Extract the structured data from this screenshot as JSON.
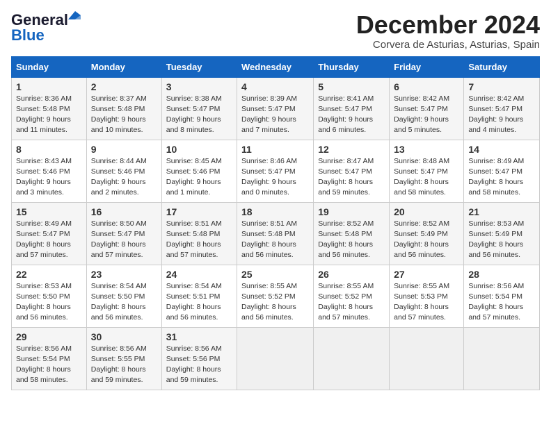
{
  "header": {
    "logo_line1": "General",
    "logo_line2": "Blue",
    "month_title": "December 2024",
    "location": "Corvera de Asturias, Asturias, Spain"
  },
  "weekdays": [
    "Sunday",
    "Monday",
    "Tuesday",
    "Wednesday",
    "Thursday",
    "Friday",
    "Saturday"
  ],
  "weeks": [
    [
      {
        "day": "1",
        "sunrise": "8:36 AM",
        "sunset": "5:48 PM",
        "daylight": "9 hours and 11 minutes."
      },
      {
        "day": "2",
        "sunrise": "8:37 AM",
        "sunset": "5:48 PM",
        "daylight": "9 hours and 10 minutes."
      },
      {
        "day": "3",
        "sunrise": "8:38 AM",
        "sunset": "5:47 PM",
        "daylight": "9 hours and 8 minutes."
      },
      {
        "day": "4",
        "sunrise": "8:39 AM",
        "sunset": "5:47 PM",
        "daylight": "9 hours and 7 minutes."
      },
      {
        "day": "5",
        "sunrise": "8:41 AM",
        "sunset": "5:47 PM",
        "daylight": "9 hours and 6 minutes."
      },
      {
        "day": "6",
        "sunrise": "8:42 AM",
        "sunset": "5:47 PM",
        "daylight": "9 hours and 5 minutes."
      },
      {
        "day": "7",
        "sunrise": "8:42 AM",
        "sunset": "5:47 PM",
        "daylight": "9 hours and 4 minutes."
      }
    ],
    [
      {
        "day": "8",
        "sunrise": "8:43 AM",
        "sunset": "5:46 PM",
        "daylight": "9 hours and 3 minutes."
      },
      {
        "day": "9",
        "sunrise": "8:44 AM",
        "sunset": "5:46 PM",
        "daylight": "9 hours and 2 minutes."
      },
      {
        "day": "10",
        "sunrise": "8:45 AM",
        "sunset": "5:46 PM",
        "daylight": "9 hours and 1 minute."
      },
      {
        "day": "11",
        "sunrise": "8:46 AM",
        "sunset": "5:47 PM",
        "daylight": "9 hours and 0 minutes."
      },
      {
        "day": "12",
        "sunrise": "8:47 AM",
        "sunset": "5:47 PM",
        "daylight": "8 hours and 59 minutes."
      },
      {
        "day": "13",
        "sunrise": "8:48 AM",
        "sunset": "5:47 PM",
        "daylight": "8 hours and 58 minutes."
      },
      {
        "day": "14",
        "sunrise": "8:49 AM",
        "sunset": "5:47 PM",
        "daylight": "8 hours and 58 minutes."
      }
    ],
    [
      {
        "day": "15",
        "sunrise": "8:49 AM",
        "sunset": "5:47 PM",
        "daylight": "8 hours and 57 minutes."
      },
      {
        "day": "16",
        "sunrise": "8:50 AM",
        "sunset": "5:47 PM",
        "daylight": "8 hours and 57 minutes."
      },
      {
        "day": "17",
        "sunrise": "8:51 AM",
        "sunset": "5:48 PM",
        "daylight": "8 hours and 57 minutes."
      },
      {
        "day": "18",
        "sunrise": "8:51 AM",
        "sunset": "5:48 PM",
        "daylight": "8 hours and 56 minutes."
      },
      {
        "day": "19",
        "sunrise": "8:52 AM",
        "sunset": "5:48 PM",
        "daylight": "8 hours and 56 minutes."
      },
      {
        "day": "20",
        "sunrise": "8:52 AM",
        "sunset": "5:49 PM",
        "daylight": "8 hours and 56 minutes."
      },
      {
        "day": "21",
        "sunrise": "8:53 AM",
        "sunset": "5:49 PM",
        "daylight": "8 hours and 56 minutes."
      }
    ],
    [
      {
        "day": "22",
        "sunrise": "8:53 AM",
        "sunset": "5:50 PM",
        "daylight": "8 hours and 56 minutes."
      },
      {
        "day": "23",
        "sunrise": "8:54 AM",
        "sunset": "5:50 PM",
        "daylight": "8 hours and 56 minutes."
      },
      {
        "day": "24",
        "sunrise": "8:54 AM",
        "sunset": "5:51 PM",
        "daylight": "8 hours and 56 minutes."
      },
      {
        "day": "25",
        "sunrise": "8:55 AM",
        "sunset": "5:52 PM",
        "daylight": "8 hours and 56 minutes."
      },
      {
        "day": "26",
        "sunrise": "8:55 AM",
        "sunset": "5:52 PM",
        "daylight": "8 hours and 57 minutes."
      },
      {
        "day": "27",
        "sunrise": "8:55 AM",
        "sunset": "5:53 PM",
        "daylight": "8 hours and 57 minutes."
      },
      {
        "day": "28",
        "sunrise": "8:56 AM",
        "sunset": "5:54 PM",
        "daylight": "8 hours and 57 minutes."
      }
    ],
    [
      {
        "day": "29",
        "sunrise": "8:56 AM",
        "sunset": "5:54 PM",
        "daylight": "8 hours and 58 minutes."
      },
      {
        "day": "30",
        "sunrise": "8:56 AM",
        "sunset": "5:55 PM",
        "daylight": "8 hours and 59 minutes."
      },
      {
        "day": "31",
        "sunrise": "8:56 AM",
        "sunset": "5:56 PM",
        "daylight": "8 hours and 59 minutes."
      },
      null,
      null,
      null,
      null
    ]
  ]
}
